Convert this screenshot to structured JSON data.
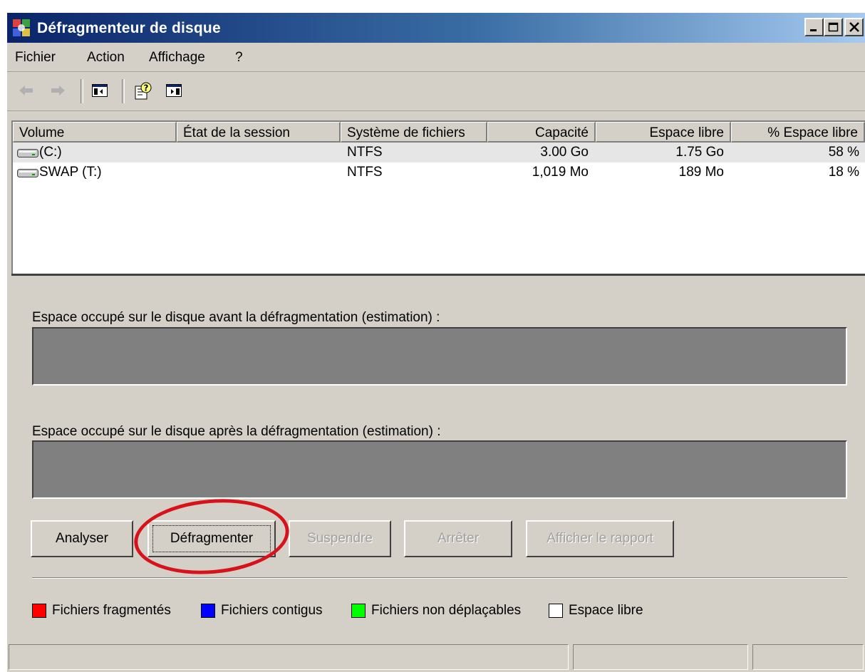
{
  "window": {
    "title": "Défragmenteur de disque"
  },
  "menu": {
    "items": [
      "Fichier",
      "Action",
      "Affichage",
      "?"
    ]
  },
  "toolbar": {
    "icons": [
      "back-arrow-icon",
      "forward-arrow-icon",
      "show-hide-console-tree-icon",
      "help-icon",
      "show-hide-action-pane-icon"
    ]
  },
  "volumes": {
    "columns": [
      "Volume",
      "État de la session",
      "Système de fichiers",
      "Capacité",
      "Espace libre",
      "% Espace libre"
    ],
    "rows": [
      {
        "volume": "(C:)",
        "session": "",
        "filesystem": "NTFS",
        "capacity": "3.00 Go",
        "free": "1.75 Go",
        "free_pct": "58 %"
      },
      {
        "volume": "SWAP (T:)",
        "session": "",
        "filesystem": "NTFS",
        "capacity": "1,019 Mo",
        "free": "189 Mo",
        "free_pct": "18 %"
      }
    ]
  },
  "analysis": {
    "before_label": "Espace occupé sur le disque avant la défragmentation (estimation) :",
    "after_label": "Espace occupé sur le disque après la défragmentation (estimation) :"
  },
  "buttons": {
    "analyze": "Analyser",
    "defragment": "Défragmenter",
    "pause": "Suspendre",
    "stop": "Arrêter",
    "view_report": "Afficher le rapport"
  },
  "legend": [
    {
      "label": "Fichiers fragmentés",
      "color": "#ff0000"
    },
    {
      "label": "Fichiers contigus",
      "color": "#0000ff"
    },
    {
      "label": "Fichiers non déplaçables",
      "color": "#00ff00"
    },
    {
      "label": "Espace libre",
      "color": "#ffffff"
    }
  ],
  "colors": {
    "highlight_ring": "#d8121b",
    "bar_fill": "#808080"
  }
}
